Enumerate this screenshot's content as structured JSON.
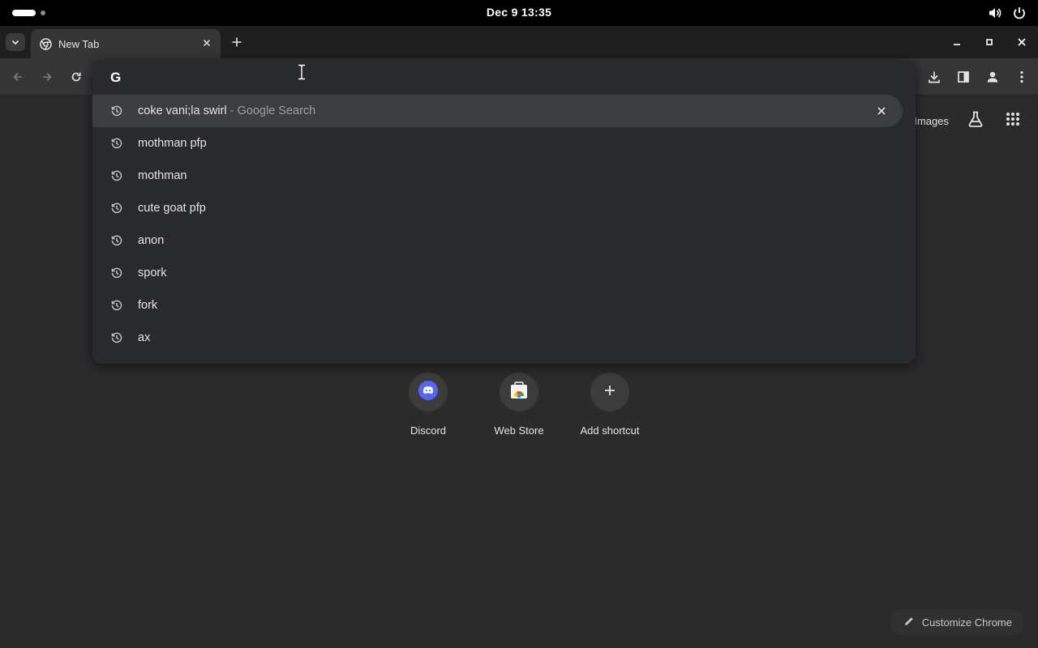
{
  "system": {
    "clock": "Dec 9  13:35"
  },
  "tab": {
    "title": "New Tab"
  },
  "omnibox": {
    "input_value": "",
    "suggestions": [
      {
        "text": "coke vani;la swirl",
        "suffix": " - Google Search"
      },
      {
        "text": "mothman pfp"
      },
      {
        "text": "mothman"
      },
      {
        "text": "cute goat pfp"
      },
      {
        "text": "anon"
      },
      {
        "text": "spork"
      },
      {
        "text": "fork"
      },
      {
        "text": "ax"
      }
    ]
  },
  "ntp": {
    "images_link": "Images",
    "shortcuts": [
      {
        "label": "Discord",
        "icon": "discord-icon"
      },
      {
        "label": "Web Store",
        "icon": "web-store-icon"
      },
      {
        "label": "Add shortcut",
        "icon": "plus-icon"
      }
    ],
    "customize_label": "Customize Chrome"
  },
  "colors": {
    "background": "#2b2b2b",
    "omnibox_bg": "#282a2d",
    "discord": "#5865f2"
  }
}
